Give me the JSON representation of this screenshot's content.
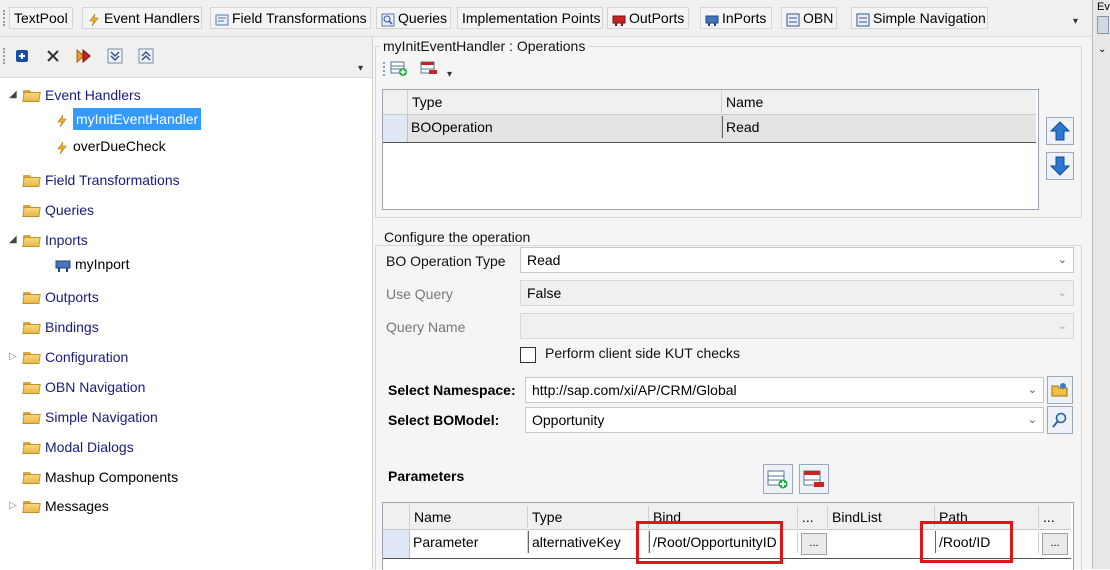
{
  "tabs": [
    {
      "label": "TextPool",
      "icon": "none"
    },
    {
      "label": "Event Handlers",
      "icon": "lightning-icon"
    },
    {
      "label": "Field Transformations",
      "icon": "transform-icon"
    },
    {
      "label": "Queries",
      "icon": "query-icon"
    },
    {
      "label": "Implementation Points",
      "icon": "none"
    },
    {
      "label": "OutPorts",
      "icon": "outport-icon"
    },
    {
      "label": "InPorts",
      "icon": "inport-icon"
    },
    {
      "label": "OBN",
      "icon": "obn-icon"
    },
    {
      "label": "Simple Navigation",
      "icon": "navigation-icon"
    }
  ],
  "right_strip": {
    "label": "Ev"
  },
  "tree": {
    "event_handlers": "Event Handlers",
    "my_init": "myInitEventHandler",
    "overdue": "overDueCheck",
    "field_transformations": "Field Transformations",
    "queries": "Queries",
    "inports": "Inports",
    "my_inport": "myInport",
    "outports": "Outports",
    "bindings": "Bindings",
    "configuration": "Configuration",
    "obn": "OBN Navigation",
    "simple_nav": "Simple Navigation",
    "modal": "Modal Dialogs",
    "mashup": "Mashup Components",
    "messages": "Messages"
  },
  "operations": {
    "title": "myInitEventHandler : Operations",
    "columns": [
      "Type",
      "Name"
    ],
    "rows": [
      {
        "type": "BOOperation",
        "name": "Read"
      }
    ]
  },
  "configure": {
    "title": "Configure the operation",
    "bo_op_type_label": "BO Operation Type",
    "bo_op_type_value": "Read",
    "use_query_label": "Use Query",
    "use_query_value": "False",
    "query_name_label": "Query Name",
    "query_name_value": "",
    "kut_checkbox_label": "Perform client side KUT checks",
    "kut_checked": false,
    "namespace_label": "Select Namespace:",
    "namespace_value": "http://sap.com/xi/AP/CRM/Global",
    "bomodel_label": "Select BOModel:",
    "bomodel_value": "Opportunity"
  },
  "parameters": {
    "title": "Parameters",
    "columns": [
      "Name",
      "Type",
      "Bind",
      "...",
      "BindList",
      "Path",
      "..."
    ],
    "rows": [
      {
        "name": "Parameter",
        "type": "alternativeKey",
        "bind": "/Root/OpportunityID",
        "bind_btn": "...",
        "bindlist": "",
        "path": "/Root/ID",
        "path_btn": "..."
      }
    ]
  },
  "colors": {
    "selection": "#3399ff",
    "highlight_box": "#e0141b",
    "tree_text": "#1a1a80"
  }
}
